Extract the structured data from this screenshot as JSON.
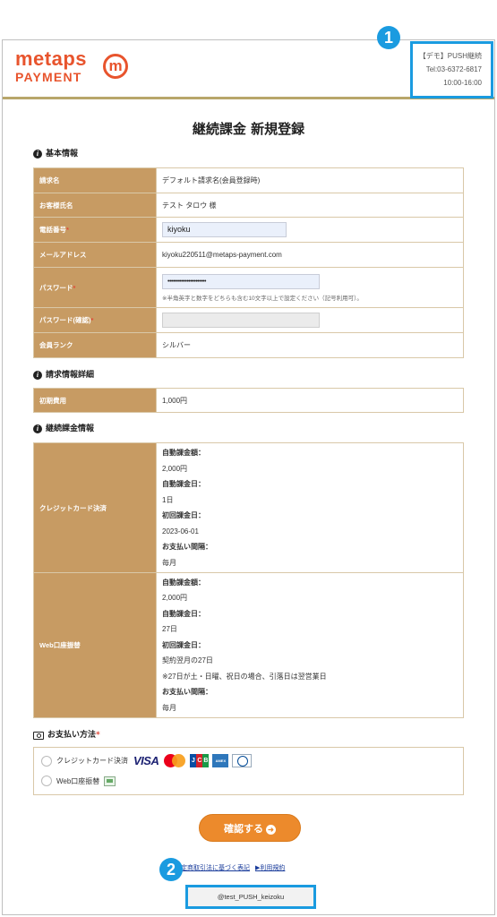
{
  "header": {
    "logo_top": "metaps",
    "logo_badge": "m",
    "logo_bottom": "PAYMENT",
    "contact_line1": "【デモ】PUSH継続",
    "contact_line2": "Tel:03-6372-6817",
    "contact_line3": "10:00-16:00"
  },
  "badges": {
    "one": "1",
    "two": "2"
  },
  "page_title": "継続課金 新規登録",
  "basic_info": {
    "heading": "基本情報",
    "rows": {
      "billing_name_label": "請求名",
      "billing_name_value": "デフォルト請求名(会員登録時)",
      "customer_name_label": "お客様氏名",
      "customer_name_value": "テスト タロウ 様",
      "phone_label": "電話番号",
      "phone_value": "kiyoku",
      "email_label": "メールアドレス",
      "email_value": "kiyoku220511@metaps-payment.com",
      "password_label": "パスワード",
      "password_value": "••••••••••••••••••••••",
      "password_note": "※半角英字と数字をどちらも含む10文字以上で設定ください（記号利用可）。",
      "password_confirm_label": "パスワード(確認)",
      "password_confirm_value": "",
      "rank_label": "会員ランク",
      "rank_value": "シルバー"
    }
  },
  "billing_detail": {
    "heading": "請求情報詳細",
    "initial_fee_label": "初期費用",
    "initial_fee_value": "1,000円"
  },
  "recurring_info": {
    "heading": "継続課金情報",
    "credit": {
      "label": "クレジットカード決済",
      "amount_label": "自動課金額：",
      "amount_value": "2,000円",
      "day_label": "自動課金日：",
      "day_value": "1日",
      "first_label": "初回課金日：",
      "first_value": "2023-06-01",
      "interval_label": "お支払い間隔：",
      "interval_value": "毎月"
    },
    "web_bank": {
      "label": "Web口座振替",
      "amount_label": "自動課金額：",
      "amount_value": "2,000円",
      "day_label": "自動課金日：",
      "day_value": "27日",
      "first_label": "初回課金日：",
      "first_value": "契約翌月の27日",
      "first_note": "※27日が土・日曜、祝日の場合、引落日は翌営業日",
      "interval_label": "お支払い間隔：",
      "interval_value": "毎月"
    }
  },
  "payment_method": {
    "heading": "お支払い方法",
    "option_credit": "クレジットカード決済",
    "visa_text": "VISA",
    "jcb_text": [
      "J",
      "C",
      "B"
    ],
    "amex_text": "AMEX",
    "option_bank": "Web口座振替"
  },
  "confirm_button": {
    "label": "確認する",
    "arrow": "➜"
  },
  "footer": {
    "link_tokushoho": "特定商取引法に基づく表記",
    "link_terms": "▶利用規約",
    "account_id": "@test_PUSH_keizoku"
  },
  "colors": {
    "label_bg": "#c79b63",
    "accent_orange": "#ec8a2c",
    "brand": "#e8542d",
    "highlight_blue": "#1a9be0"
  }
}
